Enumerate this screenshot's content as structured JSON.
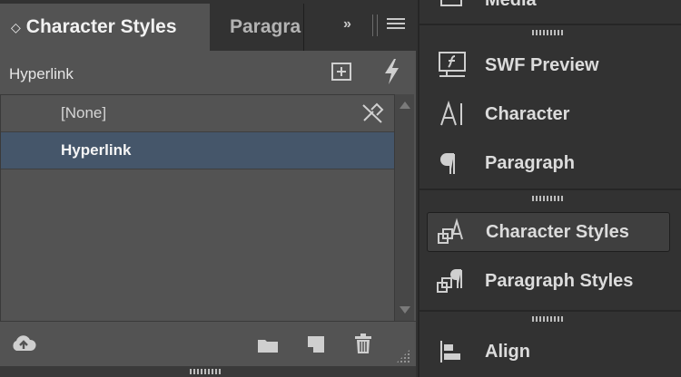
{
  "tabs": {
    "active_label": "Character Styles",
    "inactive_label": "Paragra",
    "chevron": "◇",
    "overflow": "»"
  },
  "header": {
    "current_style": "Hyperlink"
  },
  "styles_list": [
    {
      "label": "[None]",
      "selected": false
    },
    {
      "label": "Hyperlink",
      "selected": true
    }
  ],
  "icons": {
    "new_group": "new-style-group-icon",
    "lightning": "quick-apply-icon",
    "no_break": "clear-overrides-icon",
    "cc_libraries": "cc-libraries-icon",
    "folder": "new-group-icon",
    "new_style": "new-style-icon",
    "trash": "delete-icon"
  },
  "dock": {
    "top_partial": "Media",
    "items": [
      {
        "label": "SWF Preview",
        "icon": "swf-preview-icon"
      },
      {
        "label": "Character",
        "icon": "character-icon"
      },
      {
        "label": "Paragraph",
        "icon": "paragraph-icon"
      },
      {
        "label": "Character Styles",
        "icon": "character-styles-icon",
        "selected": true
      },
      {
        "label": "Paragraph Styles",
        "icon": "paragraph-styles-icon"
      },
      {
        "label": "Align",
        "icon": "align-icon"
      }
    ]
  },
  "colors": {
    "panel_bg": "#535353",
    "dock_bg": "#323232",
    "selection": "#45566a"
  }
}
